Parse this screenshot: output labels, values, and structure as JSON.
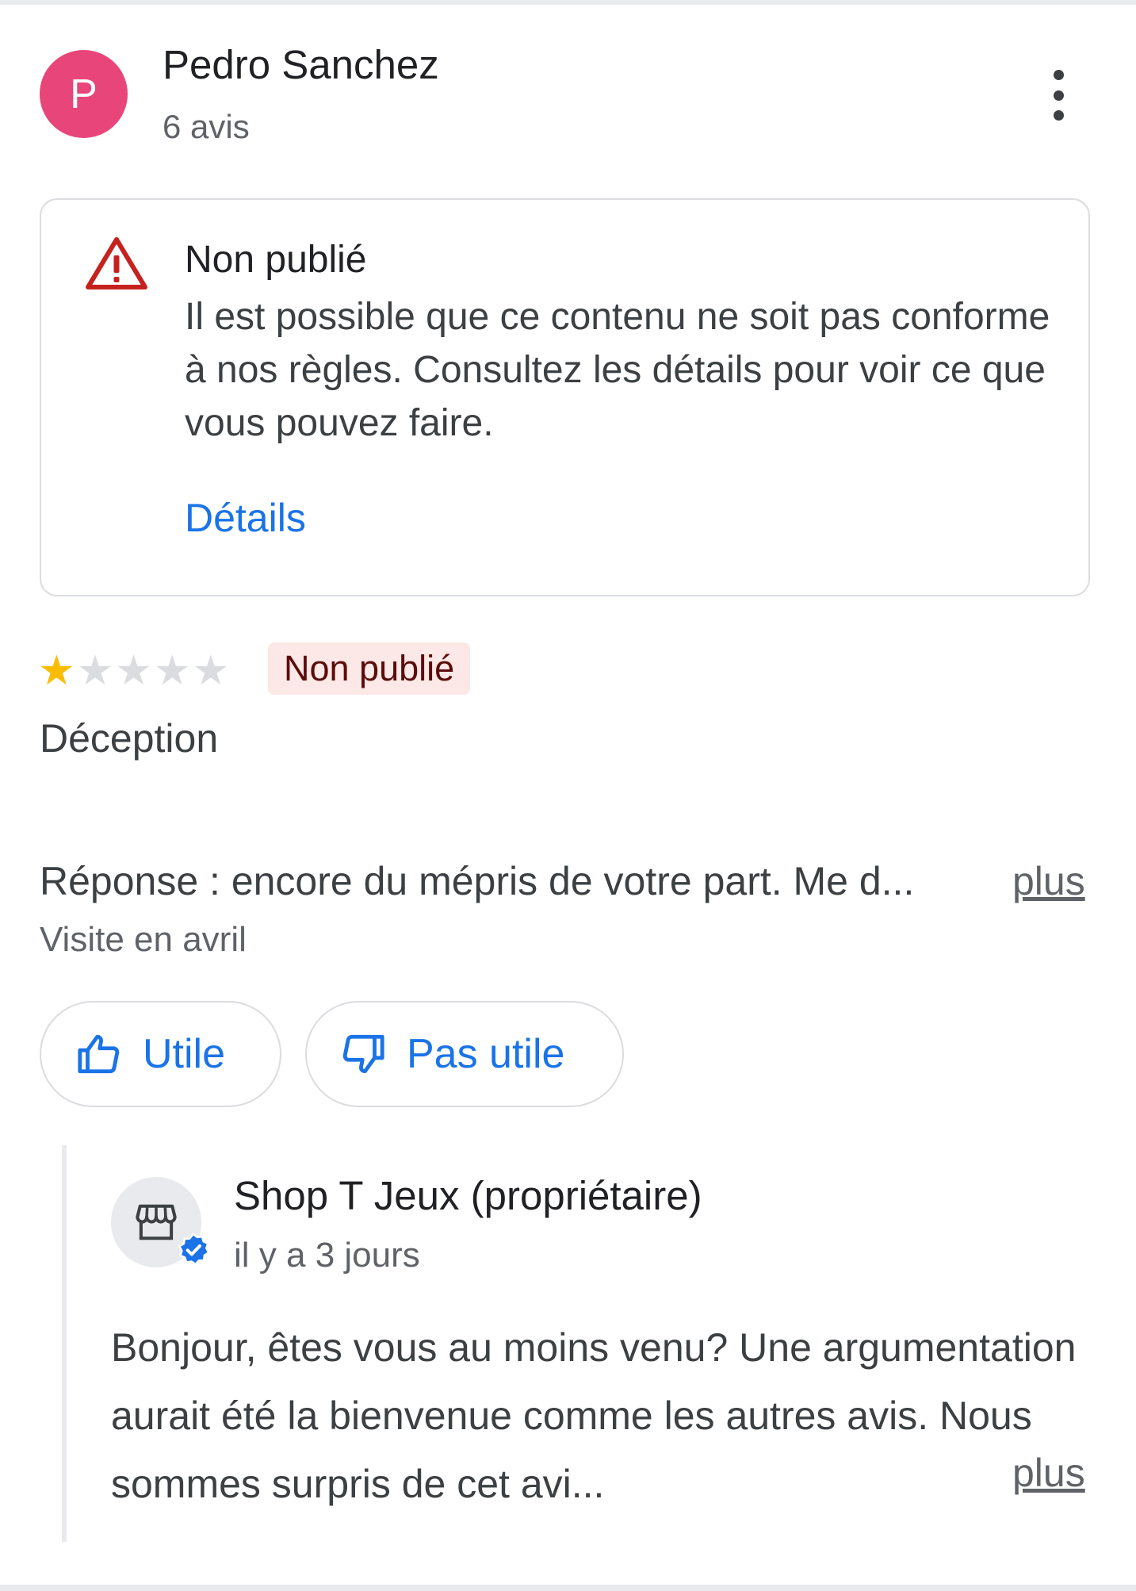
{
  "review": {
    "user_initial": "P",
    "user_name": "Pedro Sanchez",
    "review_count": "6 avis",
    "avatar_color": "#e8457a",
    "more_menu_icon": "more-vert-icon",
    "notice": {
      "icon": "warning-triangle-icon",
      "title": "Non publié",
      "body": "Il est possible que ce contenu ne soit pas conforme à nos règles. Consultez les détails pour voir ce que vous pouvez faire.",
      "link": "Détails"
    },
    "rating": 1,
    "rating_max": 5,
    "status_badge": "Non publié",
    "title": "Déception",
    "text": "Réponse : encore du mépris de votre part. Me d...",
    "more_label": "plus",
    "visit": "Visite en avril",
    "useful_label": "Utile",
    "not_useful_label": "Pas utile"
  },
  "owner_reply": {
    "name": "Shop T Jeux (propriétaire)",
    "time": "il y a 3 jours",
    "avatar_icon": "storefront-icon",
    "badge_icon": "verified-check-icon",
    "text": "Bonjour, êtes vous au moins venu? Une argumentation aurait été la bienvenue comme les autres avis. Nous sommes surpris de cet avi...",
    "more_label": "plus"
  },
  "colors": {
    "link_blue": "#1a73e8",
    "star_yellow": "#fbbc04",
    "warning_red": "#c5221f",
    "badge_bg": "#fce8e6"
  }
}
